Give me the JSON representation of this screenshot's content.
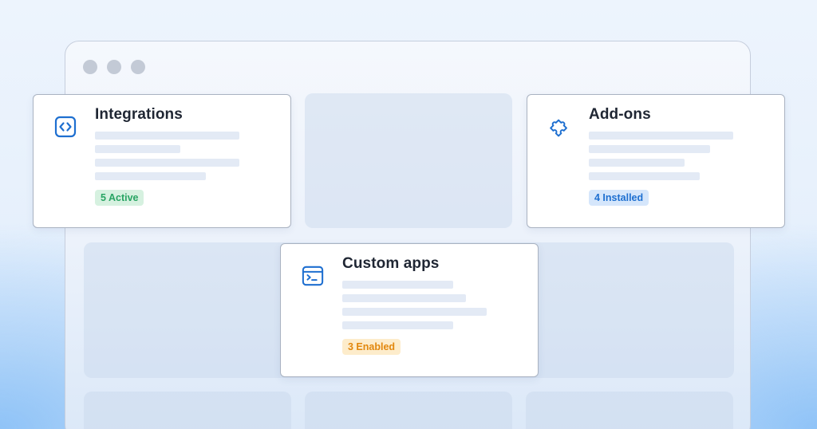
{
  "cards": [
    {
      "id": "integrations",
      "title": "Integrations",
      "icon": "code-brackets-icon",
      "badge": "5 Active",
      "badge_color": "#28a463",
      "badge_bg": "#d6f1e0"
    },
    {
      "id": "add-ons",
      "title": "Add-ons",
      "icon": "puzzle-piece-icon",
      "badge": "4 Installed",
      "badge_color": "#1e6fd0",
      "badge_bg": "#d5e6fb"
    },
    {
      "id": "custom-apps",
      "title": "Custom apps",
      "icon": "terminal-window-icon",
      "badge": "3 Enabled",
      "badge_color": "#e2870d",
      "badge_bg": "#fdeccb"
    }
  ],
  "colors": {
    "accent": "#1e6fd0",
    "card_border": "#a9b2c1",
    "window_dot": "#c3cad6"
  }
}
